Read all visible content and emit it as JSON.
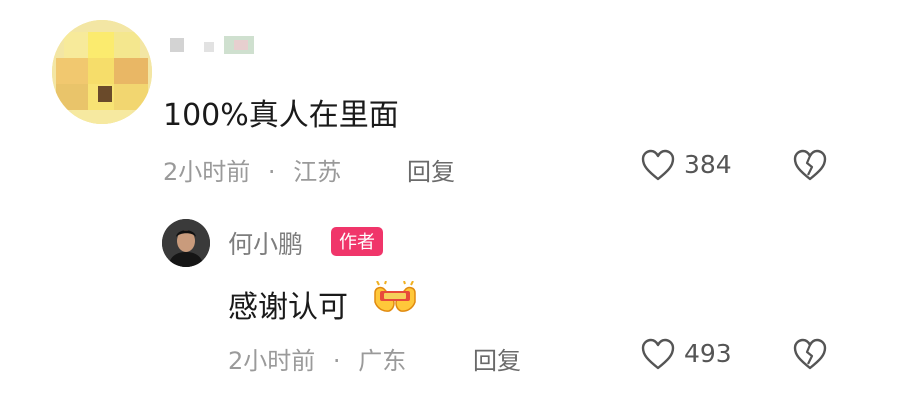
{
  "comment": {
    "text": "100%真人在里面",
    "time": "2小时前",
    "separator": "·",
    "location": "江苏",
    "reply_label": "回复",
    "likes": "384"
  },
  "reply": {
    "author": "何小鹏",
    "badge": "作者",
    "text": "感谢认可",
    "emoji_icon": "clapping-hands-emoji",
    "time": "2小时前",
    "separator": "·",
    "location": "广东",
    "reply_label": "回复",
    "likes": "493"
  },
  "colors": {
    "badge": "#f0356a",
    "meta": "#9a9a9a"
  }
}
